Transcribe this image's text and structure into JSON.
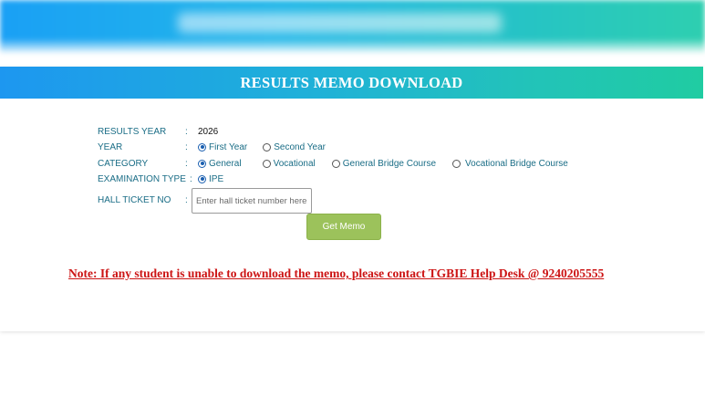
{
  "form": {
    "title": "RESULTS MEMO DOWNLOAD",
    "colon": ":",
    "results_year": {
      "label": "RESULTS YEAR",
      "value": "2026"
    },
    "year": {
      "label": "YEAR",
      "options": [
        {
          "label": "First Year",
          "selected": true
        },
        {
          "label": "Second Year",
          "selected": false
        }
      ]
    },
    "category": {
      "label": "CATEGORY",
      "options": [
        {
          "label": "General",
          "selected": true
        },
        {
          "label": "Vocational",
          "selected": false
        },
        {
          "label": "General Bridge Course",
          "selected": false
        },
        {
          "label": "Vocational Bridge Course",
          "selected": false
        }
      ]
    },
    "exam_type": {
      "label": "EXAMINATION TYPE",
      "options": [
        {
          "label": "IPE",
          "selected": true
        }
      ]
    },
    "hall_ticket": {
      "label": "HALL TICKET NO",
      "placeholder": "Enter hall ticket number here",
      "value": ""
    },
    "submit_label": "Get Memo"
  },
  "note": "Note: If any student is unable to download the memo, please contact TGBIE Help Desk @ 9240205555",
  "colors": {
    "header_start": "#1d97f0",
    "header_end": "#20cca2",
    "label": "#1a6d86",
    "button": "#9cc25b",
    "note": "#cc1414"
  }
}
